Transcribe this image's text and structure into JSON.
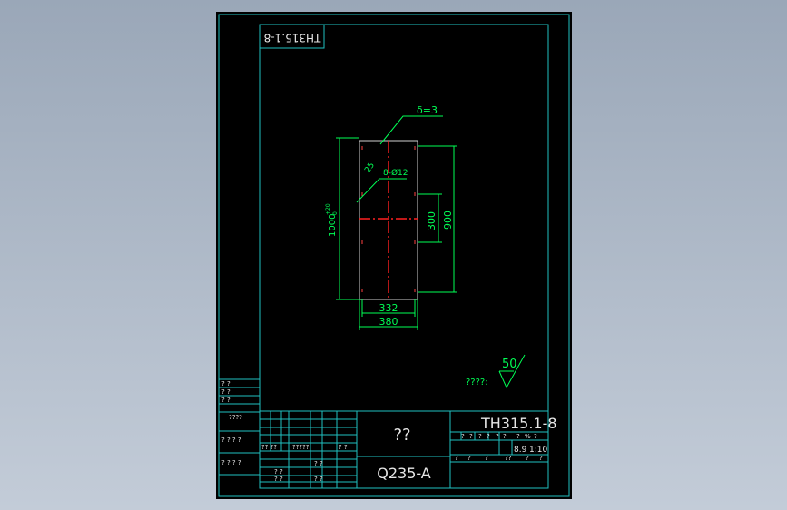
{
  "colors": {
    "background": "#000000",
    "frame": "#20c0c0",
    "dimension": "#00ff55",
    "center_line": "#ff2020",
    "title_text": "#e6e6e6",
    "viewport": "#a9b4c4"
  },
  "drawing": {
    "corner_code": "TH315.1-8",
    "thickness_label": "δ=3",
    "hole_label": "8-Ø12",
    "hole_pitch_label": "25",
    "dim_height_total": "1000",
    "dim_height_tol": "+20",
    "dim_height_tol_low": "0",
    "dim_height_900": "900",
    "dim_height_300": "300",
    "dim_width_332": "332",
    "dim_width_380": "380",
    "roughness_note": "????:",
    "roughness_value": "50"
  },
  "title_block": {
    "drawing_number": "TH315.1-8",
    "part_name": "??",
    "material": "Q235-A",
    "scale": "1:10",
    "weight": "8.9",
    "left_labels": [
      "? ?",
      "? ?",
      "? ?",
      "????",
      "? ? ? ?",
      "? ? ? ?"
    ],
    "mid_labels": [
      "?? ??",
      "?????",
      "? ?",
      "? ?",
      "? ?",
      "? ?",
      "? ?"
    ],
    "right_header": [
      "?",
      "?",
      "?",
      "?",
      "?",
      "?",
      "?",
      "%",
      "?"
    ],
    "right_row2": [
      "?",
      "?",
      "?",
      "??",
      "?",
      "?"
    ]
  }
}
